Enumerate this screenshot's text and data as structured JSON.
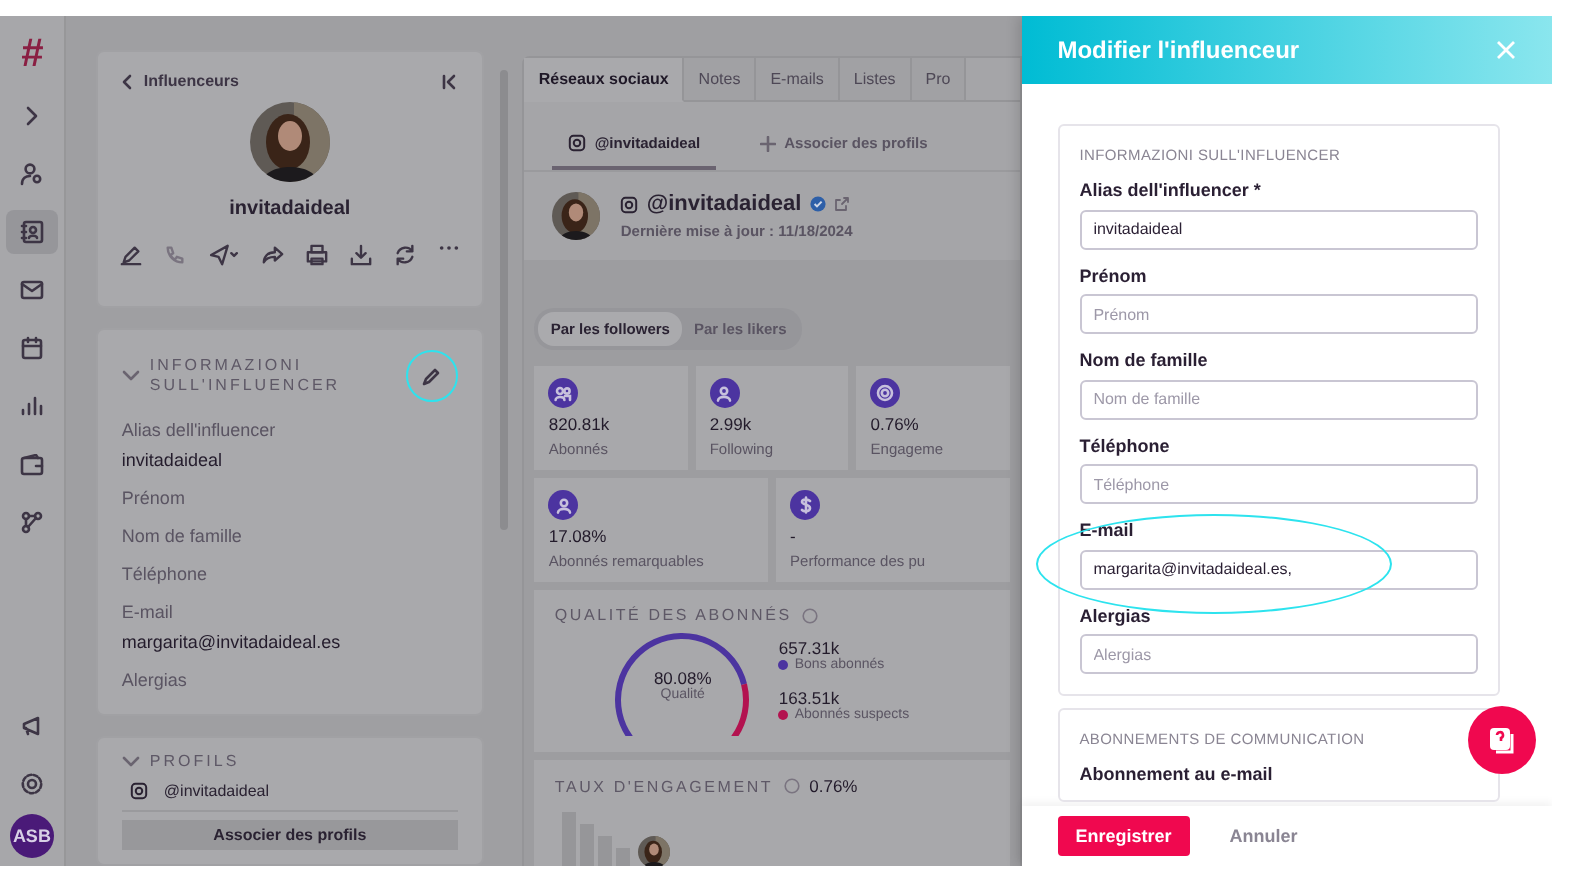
{
  "nav": {
    "logo": "#",
    "items": [
      {
        "kind": "expand",
        "selected": false
      },
      {
        "kind": "users",
        "selected": false
      },
      {
        "kind": "contacts",
        "selected": true
      },
      {
        "kind": "mail",
        "selected": false
      },
      {
        "kind": "calendar",
        "selected": false
      },
      {
        "kind": "chart",
        "selected": false
      },
      {
        "kind": "wallet",
        "selected": false
      },
      {
        "kind": "network",
        "selected": false
      }
    ],
    "bottom": [
      {
        "kind": "megaphone",
        "selected": false
      },
      {
        "kind": "settings",
        "selected": false
      }
    ],
    "user_initials": "ASB"
  },
  "profile_card": {
    "back_link": "Influenceurs",
    "name": "invitadaideal"
  },
  "info_section": {
    "title": "INFORMAZIONI SULL'INFLUENCER",
    "edit_highlighted": true,
    "fields": [
      {
        "label": "Alias dell'influencer",
        "value": "invitadaideal"
      },
      {
        "label": "Prénom"
      },
      {
        "label": "Nom de famille"
      },
      {
        "label": "Téléphone"
      },
      {
        "label": "E-mail",
        "value": "margarita@invitadaideal.es"
      },
      {
        "label": "Alergias"
      }
    ]
  },
  "profiles_section": {
    "title": "PROFILS",
    "profile": "@invitadaideal",
    "button": "Associer des profils"
  },
  "tabs": [
    {
      "label": "Réseaux sociaux",
      "selected": true
    },
    {
      "label": "Notes",
      "selected": false
    },
    {
      "label": "E-mails",
      "selected": false
    },
    {
      "label": "Listes",
      "selected": false
    },
    {
      "label": "Pro",
      "selected": false
    }
  ],
  "sub_tabs": [
    {
      "label": "@invitadaideal",
      "kind": "profile",
      "selected": true
    },
    {
      "label": "Associer des profils",
      "kind": "add",
      "selected": false
    }
  ],
  "account": {
    "handle": "@invitadaideal",
    "verified": true,
    "updated": "Dernière mise à jour : 11/18/2024"
  },
  "audience_toggle": [
    {
      "label": "Par les followers",
      "selected": true
    },
    {
      "label": "Par les likers",
      "selected": false
    }
  ],
  "stats": [
    [
      {
        "value": "820.81k",
        "label": "Abonnés"
      },
      {
        "value": "2.99k",
        "label": "Following"
      },
      {
        "value": "0.76%",
        "label": "Engageme"
      }
    ],
    [
      {
        "value": "17.08%",
        "label": "Abonnés remarquables"
      },
      {
        "value": "-",
        "label": "Performance des pu"
      }
    ]
  ],
  "quality": {
    "title": "QUALITÉ DES ABONNÉS",
    "gauge_value": "80.08%",
    "gauge_label": "Qualité",
    "level": 0.8008,
    "legend": [
      {
        "value": "657.31k",
        "label": "Bons abonnés",
        "color": "#4c34a0"
      },
      {
        "value": "163.51k",
        "label": "Abonnés suspects",
        "color": "#b3124f"
      }
    ]
  },
  "engagement": {
    "title": "TAUX D'ENGAGEMENT",
    "value": "0.76%"
  },
  "drawer": {
    "title": "Modifier l'influenceur",
    "section": "INFORMAZIONI SULL'INFLUENCER",
    "fields": [
      {
        "label": "Alias dell'influencer *",
        "value": "invitadaideal",
        "highlighted": false
      },
      {
        "label": "Prénom",
        "placeholder": "Prénom",
        "highlighted": false
      },
      {
        "label": "Nom de famille",
        "placeholder": "Nom de famille",
        "highlighted": false
      },
      {
        "label": "Téléphone",
        "placeholder": "Téléphone",
        "highlighted": false
      },
      {
        "label": "E-mail",
        "value": "margarita@invitadaideal.es,",
        "highlighted": true
      },
      {
        "label": "Alergias",
        "placeholder": "Alergias",
        "highlighted": false
      }
    ],
    "section2": "ABONNEMENTS DE COMMUNICATION",
    "section2_label": "Abonnement au e-mail",
    "save": "Enregistrer",
    "cancel": "Annuler"
  }
}
